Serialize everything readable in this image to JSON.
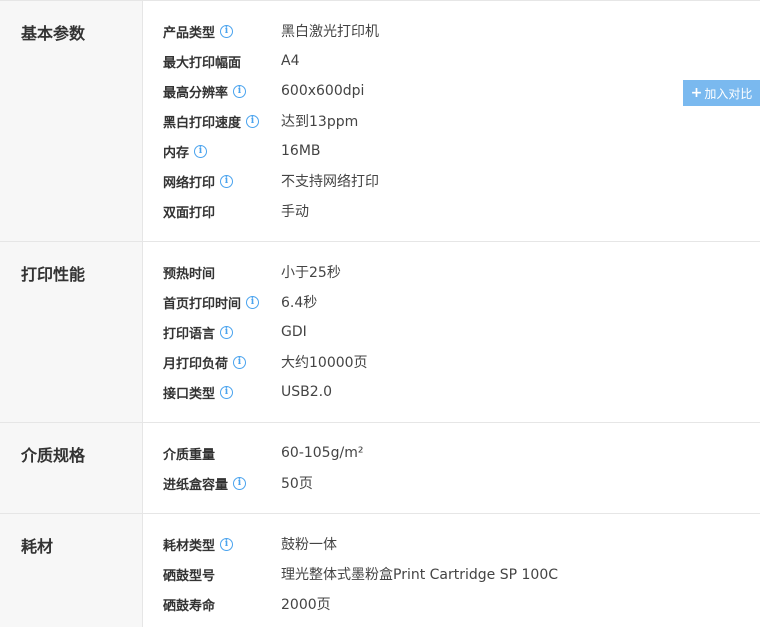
{
  "sections": [
    {
      "title": "基本参数",
      "rows": [
        {
          "label": "产品类型",
          "value": "黑白激光打印机",
          "info": true
        },
        {
          "label": "最大打印幅面",
          "value": "A4",
          "info": false
        },
        {
          "label": "最高分辨率",
          "value": "600x600dpi",
          "info": true
        },
        {
          "label": "黑白打印速度",
          "value": "达到13ppm",
          "info": true
        },
        {
          "label": "内存",
          "value": "16MB",
          "info": true
        },
        {
          "label": "网络打印",
          "value": "不支持网络打印",
          "info": true
        },
        {
          "label": "双面打印",
          "value": "手动",
          "info": false
        }
      ]
    },
    {
      "title": "打印性能",
      "rows": [
        {
          "label": "预热时间",
          "value": "小于25秒",
          "info": false
        },
        {
          "label": "首页打印时间",
          "value": "6.4秒",
          "info": true
        },
        {
          "label": "打印语言",
          "value": "GDI",
          "info": true
        },
        {
          "label": "月打印负荷",
          "value": "大约10000页",
          "info": true
        },
        {
          "label": "接口类型",
          "value": "USB2.0",
          "info": true
        }
      ]
    },
    {
      "title": "介质规格",
      "rows": [
        {
          "label": "介质重量",
          "value": "60-105g/m²",
          "info": false
        },
        {
          "label": "进纸盒容量",
          "value": "50页",
          "info": true
        }
      ]
    },
    {
      "title": "耗材",
      "rows": [
        {
          "label": "耗材类型",
          "value": "鼓粉一体",
          "info": true
        },
        {
          "label": "硒鼓型号",
          "value": "理光整体式墨粉盒Print Cartridge SP 100C",
          "info": false
        },
        {
          "label": "硒鼓寿命",
          "value": "2000页",
          "info": false
        }
      ]
    }
  ],
  "compare_button": {
    "plus": "+",
    "label": "加入对比"
  },
  "info_icon_glyph": "i",
  "colors": {
    "accent": "#4aa3ee",
    "compare_bg": "#7ab9ef",
    "title_bg": "#f7f7f7",
    "border": "#e6e6e6"
  }
}
